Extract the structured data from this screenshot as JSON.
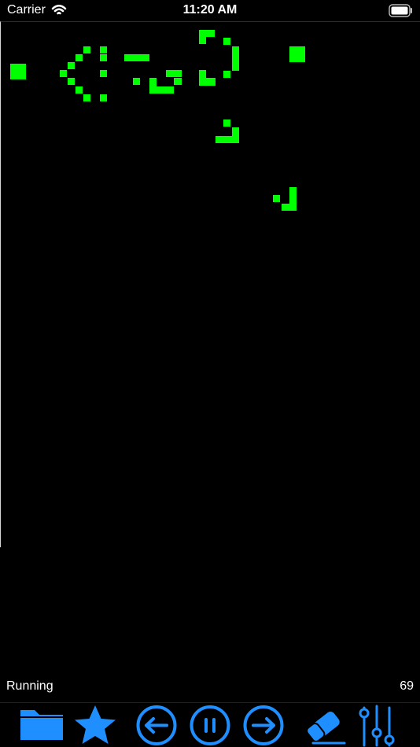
{
  "status_bar": {
    "carrier": "Carrier",
    "time": "11:20 AM",
    "wifi_icon": "wifi-icon",
    "battery_icon": "battery-icon"
  },
  "simulation": {
    "status": "Running",
    "generation": "69",
    "live_cell_color": "#00ff00",
    "background_color": "#000000",
    "accent_color": "#1f8fff"
  },
  "toolbar": {
    "items": [
      {
        "name": "files",
        "icon": "folder-icon"
      },
      {
        "name": "favorites",
        "icon": "star-icon"
      },
      {
        "name": "step-back",
        "icon": "circle-arrow-left-icon"
      },
      {
        "name": "pause",
        "icon": "pause-circle-icon"
      },
      {
        "name": "step-forward",
        "icon": "circle-arrow-right-icon"
      },
      {
        "name": "clear",
        "icon": "eraser-icon"
      },
      {
        "name": "settings",
        "icon": "sliders-icon"
      }
    ]
  }
}
